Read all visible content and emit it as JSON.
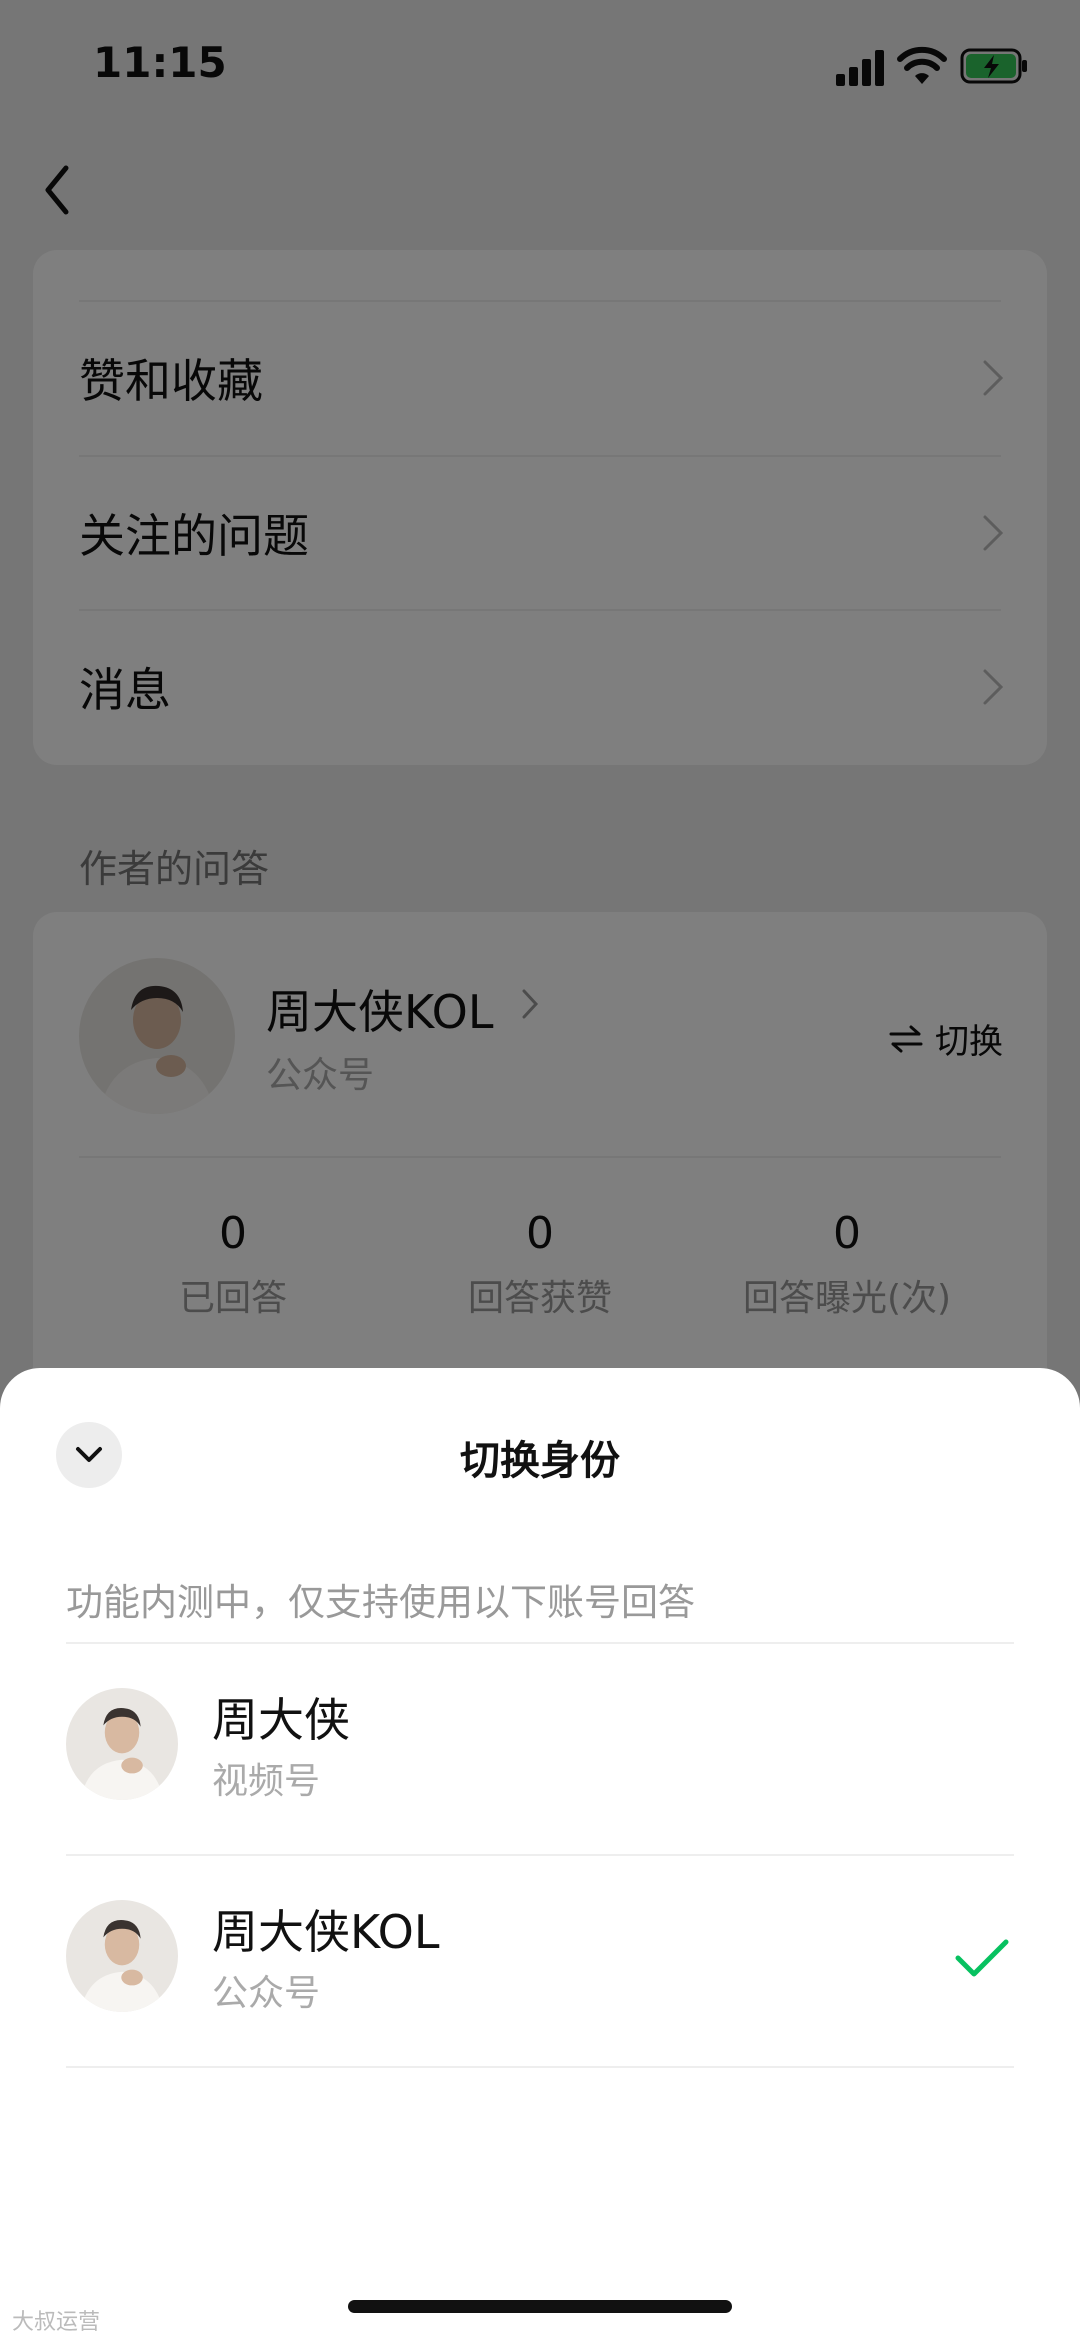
{
  "status_bar": {
    "time": "11:15"
  },
  "menu": {
    "items": [
      {
        "label": "赞和收藏"
      },
      {
        "label": "关注的问题"
      },
      {
        "label": "消息"
      }
    ]
  },
  "section": {
    "title": "作者的问答"
  },
  "author_card": {
    "name": "周大侠KOL",
    "type": "公众号",
    "switch_label": "切换",
    "stats": [
      {
        "value": "0",
        "label": "已回答"
      },
      {
        "value": "0",
        "label": "回答获赞"
      },
      {
        "value": "0",
        "label": "回答曝光(次)"
      }
    ]
  },
  "sheet": {
    "title": "切换身份",
    "notice": "功能内测中，仅支持使用以下账号回答",
    "accounts": [
      {
        "name": "周大侠",
        "type": "视频号",
        "selected": false
      },
      {
        "name": "周大侠KOL",
        "type": "公众号",
        "selected": true
      }
    ]
  },
  "colors": {
    "accent_green": "#07c160",
    "battery_green": "#34c759"
  },
  "watermark": "大叔运营"
}
